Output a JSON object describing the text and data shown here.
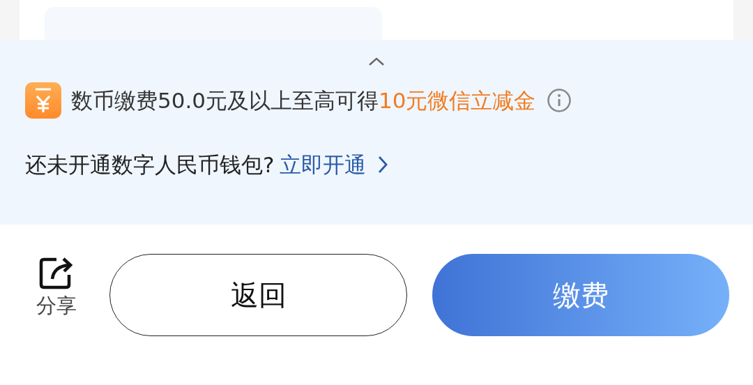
{
  "promo": {
    "text": "数币缴费50.0元及以上至高可得",
    "highlight": "10元微信立减金"
  },
  "wallet": {
    "question": "还未开通数字人民币钱包?",
    "link": "立即开通"
  },
  "share": {
    "label": "分享"
  },
  "buttons": [
    {
      "label": "返回",
      "kind": "outline"
    },
    {
      "label": "缴费",
      "kind": "primary"
    }
  ]
}
